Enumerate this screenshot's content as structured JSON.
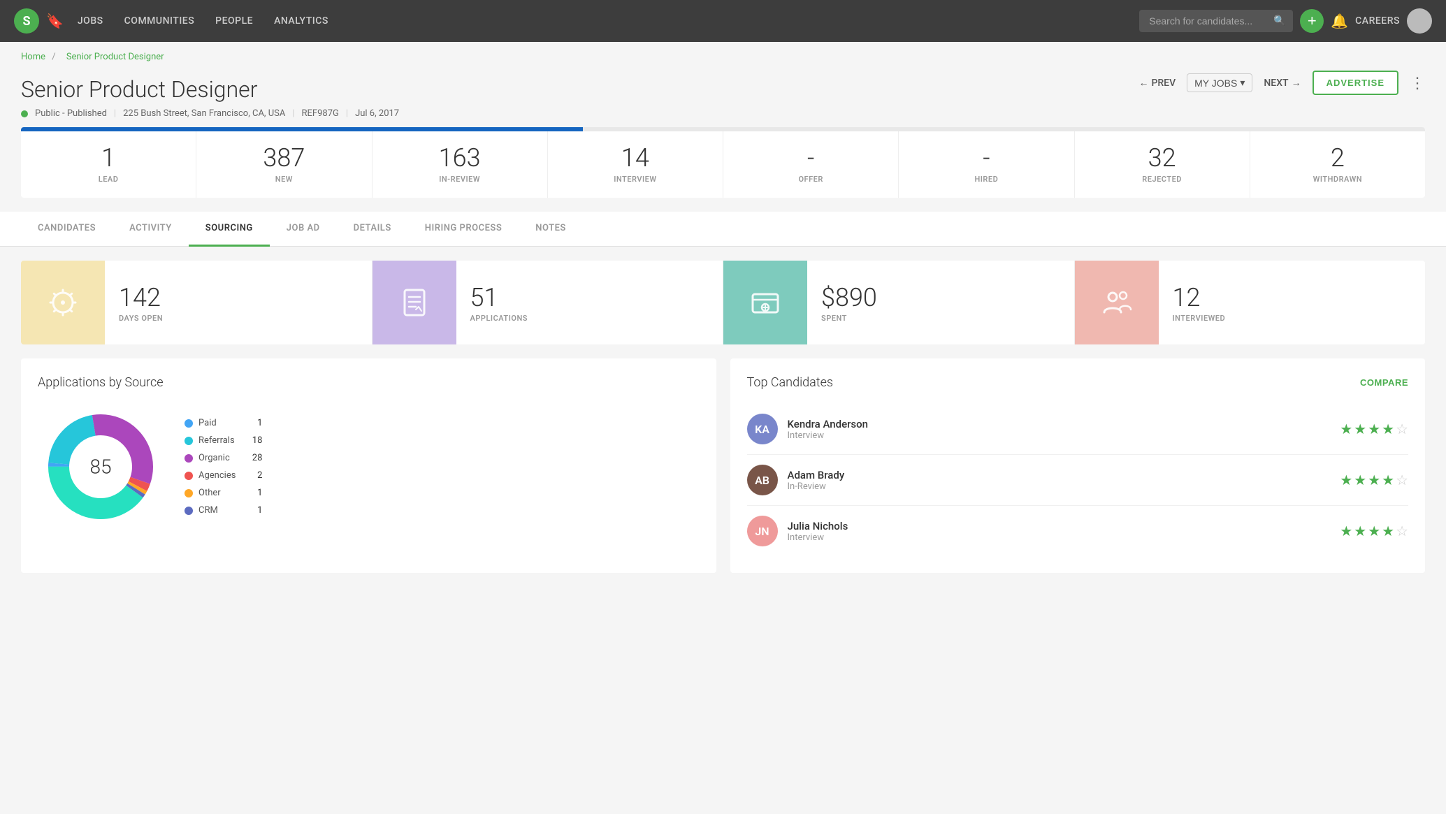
{
  "nav": {
    "logo": "S",
    "links": [
      "JOBS",
      "COMMUNITIES",
      "PEOPLE",
      "ANALYTICS"
    ],
    "search_placeholder": "Search for candidates...",
    "add_label": "+",
    "careers_label": "CAREERS"
  },
  "breadcrumb": {
    "home": "Home",
    "current": "Senior Product Designer"
  },
  "job": {
    "title": "Senior Product Designer",
    "status": "Public - Published",
    "location": "225 Bush Street, San Francisco, CA, USA",
    "ref": "REF987G",
    "date": "Jul 6, 2017"
  },
  "header_nav": {
    "prev": "PREV",
    "my_jobs": "MY JOBS",
    "next": "NEXT",
    "advertise": "ADVERTISE"
  },
  "stats": [
    {
      "value": "1",
      "label": "LEAD"
    },
    {
      "value": "387",
      "label": "NEW"
    },
    {
      "value": "163",
      "label": "IN-REVIEW"
    },
    {
      "value": "14",
      "label": "INTERVIEW"
    },
    {
      "value": "-",
      "label": "OFFER"
    },
    {
      "value": "-",
      "label": "HIRED"
    },
    {
      "value": "32",
      "label": "REJECTED"
    },
    {
      "value": "2",
      "label": "WITHDRAWN"
    }
  ],
  "tabs": [
    {
      "label": "CANDIDATES",
      "active": false
    },
    {
      "label": "ACTIVITY",
      "active": false
    },
    {
      "label": "SOURCING",
      "active": true
    },
    {
      "label": "JOB AD",
      "active": false
    },
    {
      "label": "DETAILS",
      "active": false
    },
    {
      "label": "HIRING PROCESS",
      "active": false
    },
    {
      "label": "NOTES",
      "active": false
    }
  ],
  "sourcing_cards": [
    {
      "value": "142",
      "label": "DAYS OPEN",
      "icon": "sun"
    },
    {
      "value": "51",
      "label": "APPLICATIONS",
      "icon": "document"
    },
    {
      "value": "$890",
      "label": "SPENT",
      "icon": "dollar"
    },
    {
      "value": "12",
      "label": "INTERVIEWED",
      "icon": "people"
    }
  ],
  "applications_chart": {
    "title": "Applications by Source",
    "total": "85",
    "legend": [
      {
        "label": "Paid",
        "count": 1,
        "color": "#42a5f5"
      },
      {
        "label": "Referrals",
        "count": 18,
        "color": "#26c6da"
      },
      {
        "label": "Organic",
        "count": 28,
        "color": "#ab47bc"
      },
      {
        "label": "Agencies",
        "count": 2,
        "color": "#ef5350"
      },
      {
        "label": "Other",
        "count": 1,
        "color": "#ffa726"
      },
      {
        "label": "CRM",
        "count": 1,
        "color": "#5c6bc0"
      }
    ]
  },
  "top_candidates": {
    "title": "Top Candidates",
    "compare_label": "COMPARE",
    "candidates": [
      {
        "name": "Kendra Anderson",
        "stage": "Interview",
        "stars": 4,
        "initials": "KA",
        "avatar_class": "avatar-ka"
      },
      {
        "name": "Adam Brady",
        "stage": "In-Review",
        "stars": 4,
        "initials": "AB",
        "avatar_class": "avatar-ab"
      },
      {
        "name": "Julia Nichols",
        "stage": "Interview",
        "stars": 4,
        "initials": "JN",
        "avatar_class": "avatar-jn"
      }
    ]
  }
}
